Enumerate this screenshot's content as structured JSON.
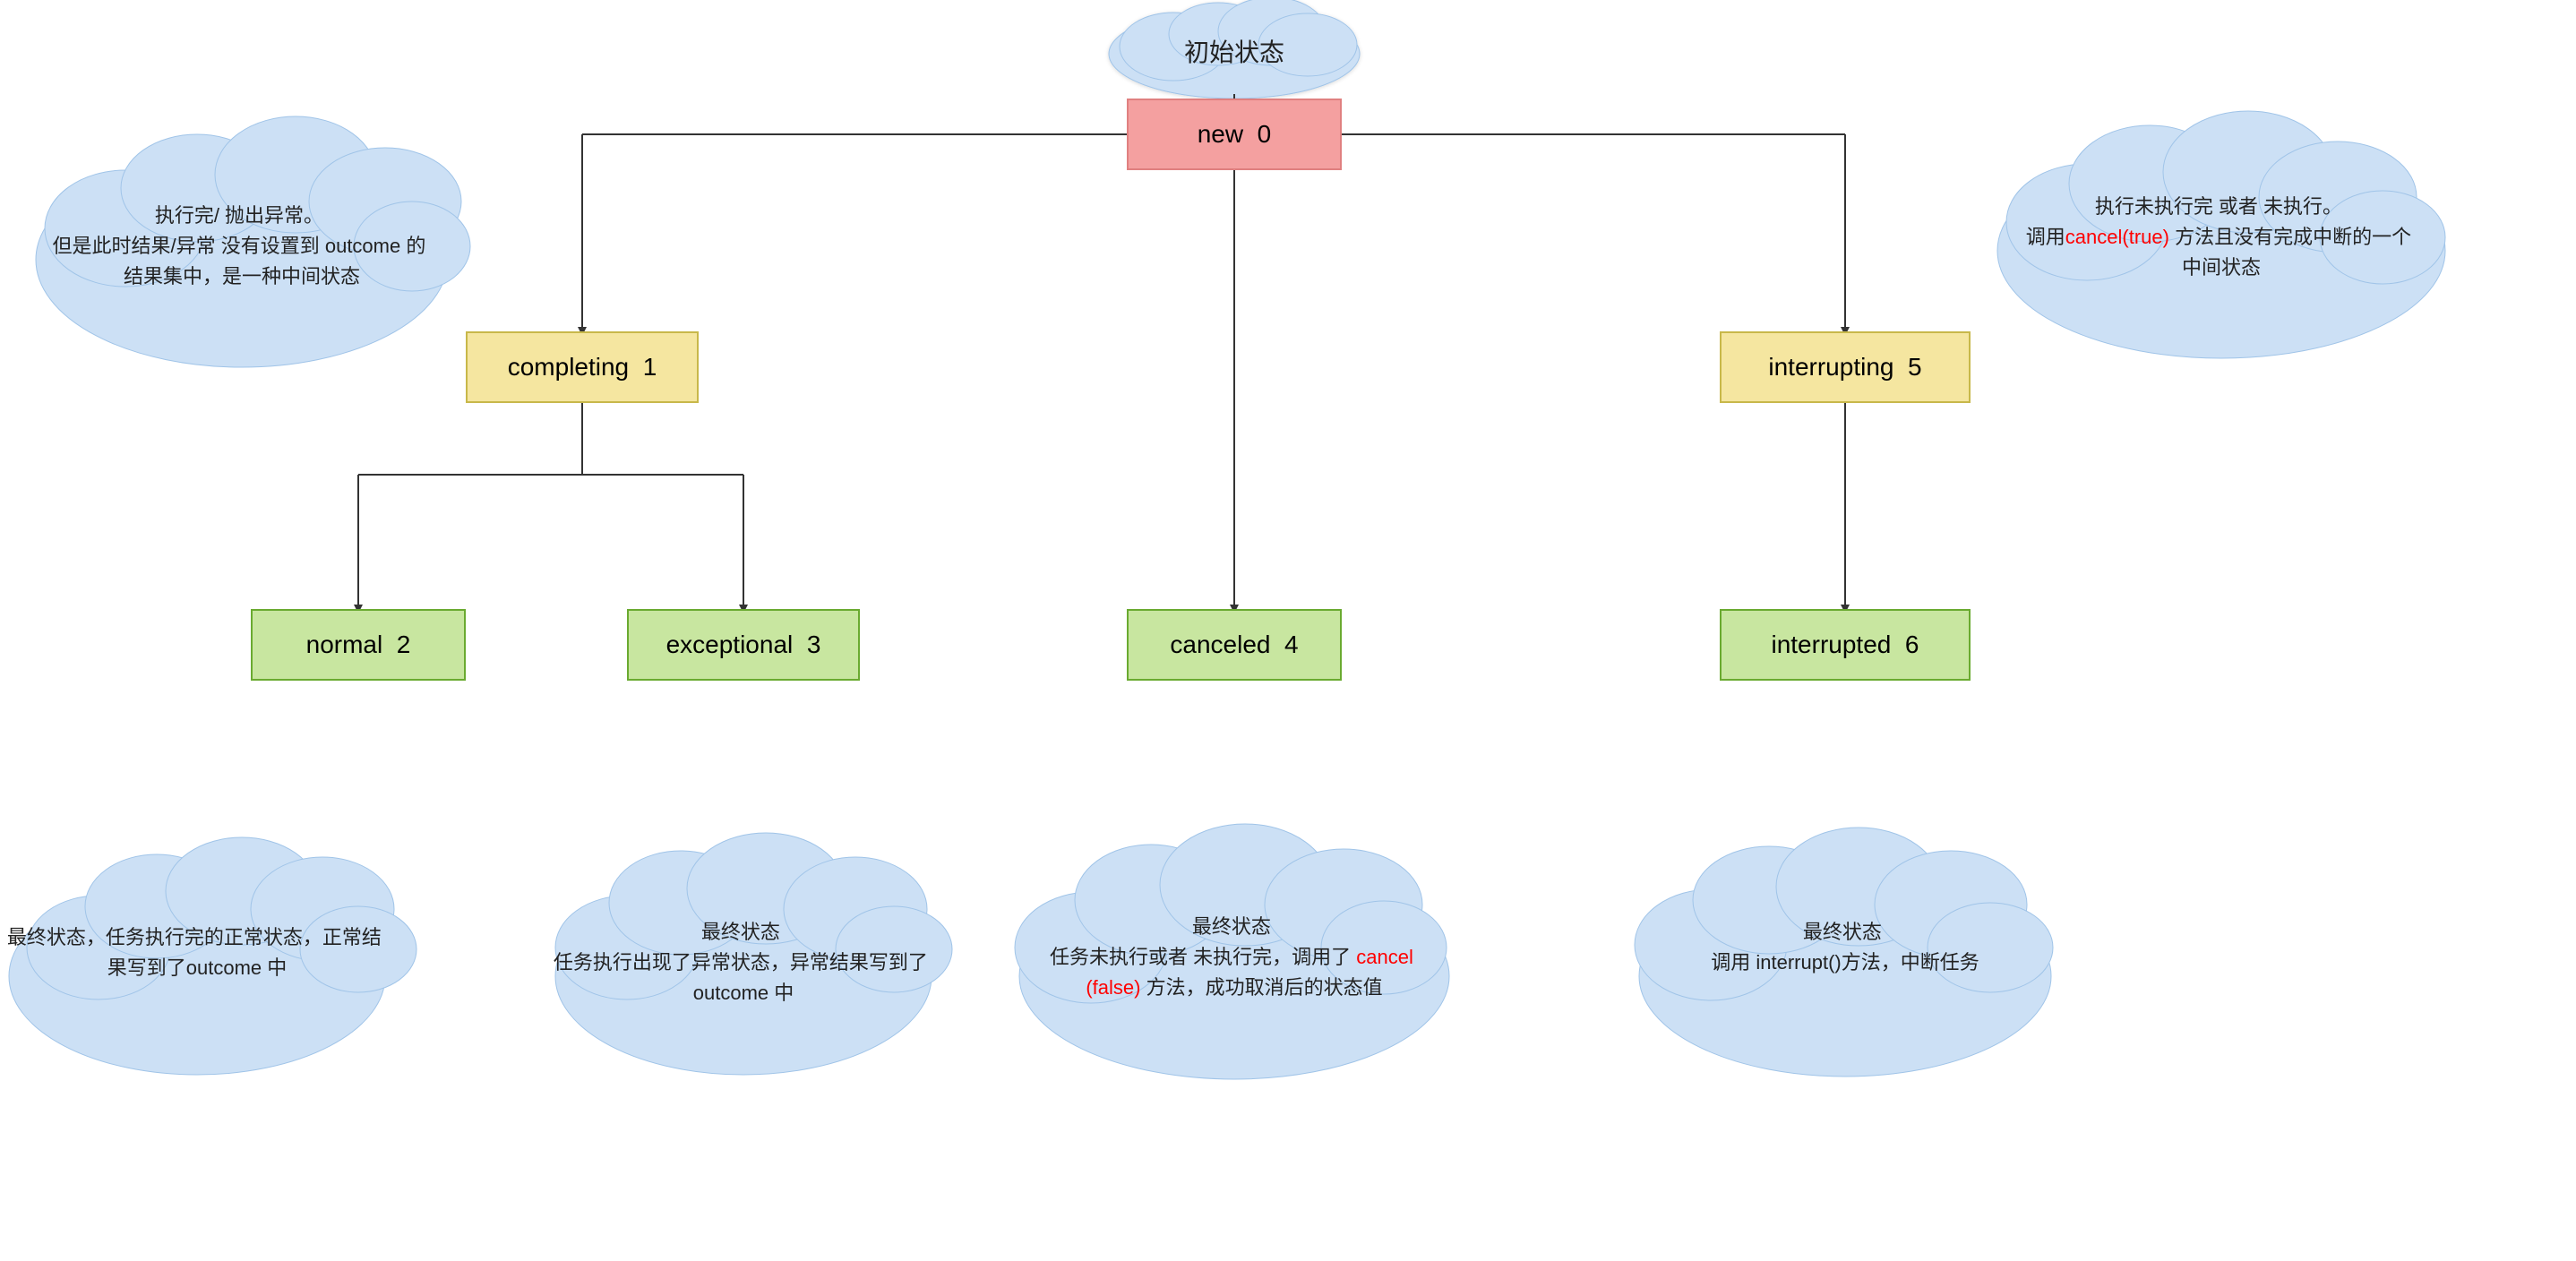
{
  "nodes": {
    "initial_state": {
      "label": "初始状态"
    },
    "new": {
      "label": "new",
      "num": "0"
    },
    "completing": {
      "label": "completing",
      "num": "1"
    },
    "interrupting": {
      "label": "interrupting",
      "num": "5"
    },
    "normal": {
      "label": "normal",
      "num": "2"
    },
    "exceptional": {
      "label": "exceptional",
      "num": "3"
    },
    "canceled": {
      "label": "canceled",
      "num": "4"
    },
    "interrupted": {
      "label": "interrupted",
      "num": "6"
    }
  },
  "clouds": {
    "top_left": {
      "text": "执行完/ 抛出异常。\n但是此时结果/异常 没有设置到 outcome 的\n结果集中，是一种中间状态"
    },
    "top_right": {
      "text_before": "执行未执行完 或者 未执行。\n调用",
      "red_text": "cancel(true)",
      "text_after": " 方法且没有完成中断的一个\n中间状态"
    },
    "bottom_normal": {
      "text": "最终状态，任务执行完的正常状态，正常结\n果写到了outcome 中"
    },
    "bottom_exceptional": {
      "text": "最终状态\n任务执行出现了异常状态，异常结果写到了\noutcome 中"
    },
    "bottom_canceled": {
      "text_before": "最终状态\n任务未执行或者 未执行完，调用了",
      "red1": "cancel",
      "text_mid": "\n",
      "red2": "(false)",
      "text_after": " 方法，成功取消后的状态值"
    },
    "bottom_interrupted": {
      "text": "最终状态\n调用 interrupt()方法，中断任务"
    }
  }
}
